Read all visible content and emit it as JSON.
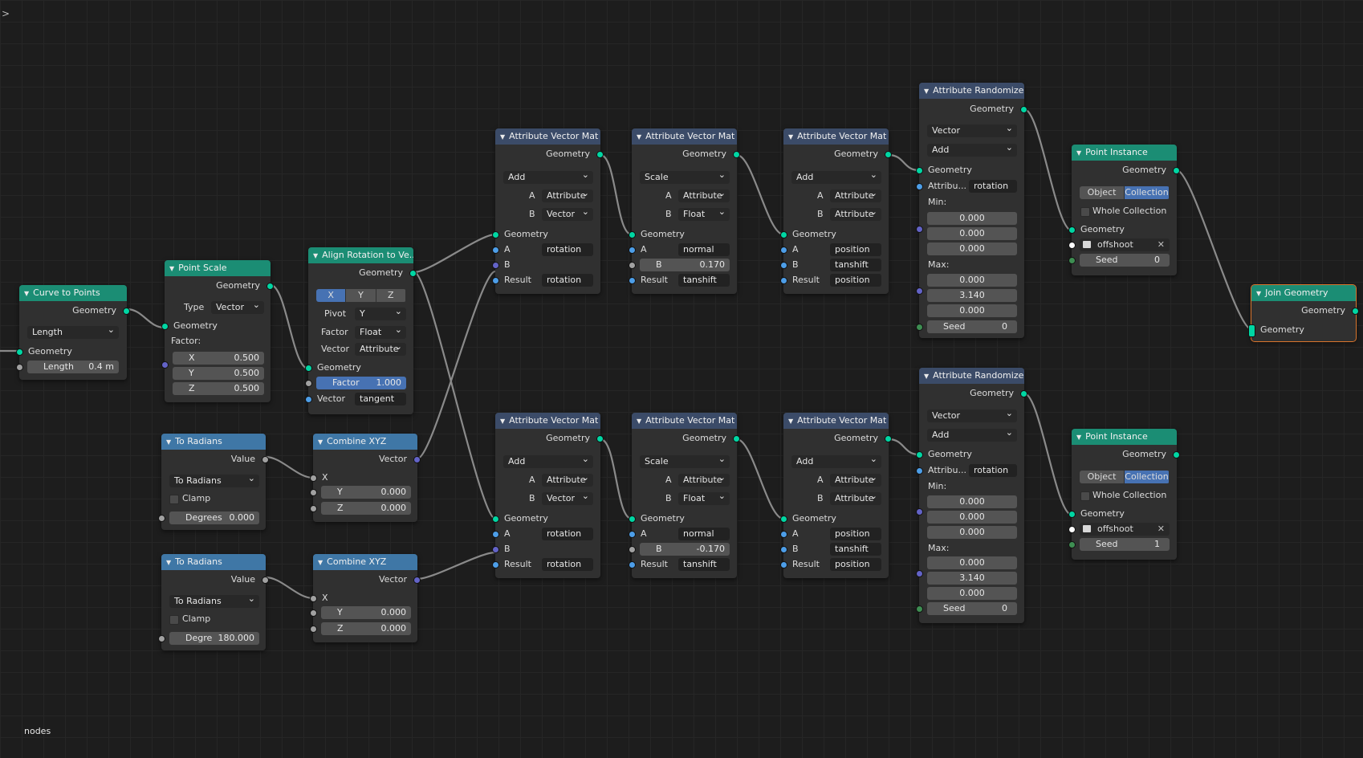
{
  "editor": {
    "label": "nodes",
    "toggle": ">"
  },
  "common": {
    "geometry": "Geometry",
    "attribute": "Attribute",
    "vector": "Vector",
    "float": "Float",
    "a": "A",
    "b": "B",
    "result": "Result",
    "x": "X",
    "y": "Y",
    "z": "Z",
    "value": "Value",
    "clamp": "Clamp",
    "min": "Min:",
    "max": "Max:",
    "seed": "Seed",
    "object": "Object",
    "collection": "Collection",
    "whole_collection": "Whole Collection",
    "factor_label": "Factor:",
    "type": "Type",
    "pivot": "Pivot",
    "factor": "Factor"
  },
  "curve_to_points": {
    "title": "Curve to Points",
    "mode": "Length",
    "length_label": "Length",
    "length_value": "0.4 m"
  },
  "point_scale": {
    "title": "Point Scale",
    "type_value": "Vector",
    "x": "0.500",
    "y": "0.500",
    "z": "0.500"
  },
  "align_rotation": {
    "title": "Align Rotation to Ve...",
    "pivot_value": "Y",
    "factor_type": "Float",
    "vector_type": "Attribute",
    "factor_value": "1.000",
    "vector_name": "tangent"
  },
  "to_radians_1": {
    "title": "To Radians",
    "op": "To Radians",
    "input_label": "Degrees",
    "input_value": "0.000"
  },
  "to_radians_2": {
    "title": "To Radians",
    "op": "To Radians",
    "input_label": "Degre",
    "input_value": "180.000"
  },
  "combine_1": {
    "title": "Combine XYZ",
    "y": "0.000",
    "z": "0.000"
  },
  "combine_2": {
    "title": "Combine XYZ",
    "y": "0.000",
    "z": "0.000"
  },
  "avm_top_1": {
    "title": "Attribute Vector Mat",
    "op": "Add",
    "a_type": "Attribute",
    "b_type": "Vector",
    "a_name": "rotation",
    "result_name": "rotation"
  },
  "avm_top_2": {
    "title": "Attribute Vector Mat",
    "op": "Scale",
    "a_type": "Attribute",
    "b_type": "Float",
    "a_name": "normal",
    "b_value": "0.170",
    "result_name": "tanshift"
  },
  "avm_top_3": {
    "title": "Attribute Vector Mat",
    "op": "Add",
    "a_type": "Attribute",
    "b_type": "Attribute",
    "a_name": "position",
    "b_name": "tanshift",
    "result_name": "position"
  },
  "avm_bot_1": {
    "title": "Attribute Vector Mat",
    "op": "Add",
    "a_type": "Attribute",
    "b_type": "Vector",
    "a_name": "rotation",
    "result_name": "rotation"
  },
  "avm_bot_2": {
    "title": "Attribute Vector Mat",
    "op": "Scale",
    "a_type": "Attribute",
    "b_type": "Float",
    "a_name": "normal",
    "b_value": "-0.170",
    "result_name": "tanshift"
  },
  "avm_bot_3": {
    "title": "Attribute Vector Mat",
    "op": "Add",
    "a_type": "Attribute",
    "b_type": "Attribute",
    "a_name": "position",
    "b_name": "tanshift",
    "result_name": "position"
  },
  "rand_1": {
    "title": "Attribute Randomize",
    "type": "Vector",
    "op": "Add",
    "attr_label": "Attribu...",
    "attr_name": "rotation",
    "min": [
      "0.000",
      "0.000",
      "0.000"
    ],
    "max": [
      "0.000",
      "3.140",
      "0.000"
    ],
    "seed_value": "0"
  },
  "rand_2": {
    "title": "Attribute Randomize",
    "type": "Vector",
    "op": "Add",
    "attr_label": "Attribu...",
    "attr_name": "rotation",
    "min": [
      "0.000",
      "0.000",
      "0.000"
    ],
    "max": [
      "0.000",
      "3.140",
      "0.000"
    ],
    "seed_value": "0"
  },
  "inst_1": {
    "title": "Point Instance",
    "collection_name": "offshoot",
    "seed_value": "0"
  },
  "inst_2": {
    "title": "Point Instance",
    "collection_name": "offshoot",
    "seed_value": "1"
  },
  "join": {
    "title": "Join Geometry"
  },
  "colors": {
    "geometry_header": "#1b8d74",
    "attribute_header": "#3b4b68",
    "converter_header": "#3f77a6",
    "geometry_socket": "#00d6a3",
    "vector_socket": "#6363c7",
    "float_socket": "#a1a1a1",
    "attribute_socket": "#4d9ee8",
    "selected_outline": "#d9742c",
    "active_toggle": "#4772b3"
  }
}
